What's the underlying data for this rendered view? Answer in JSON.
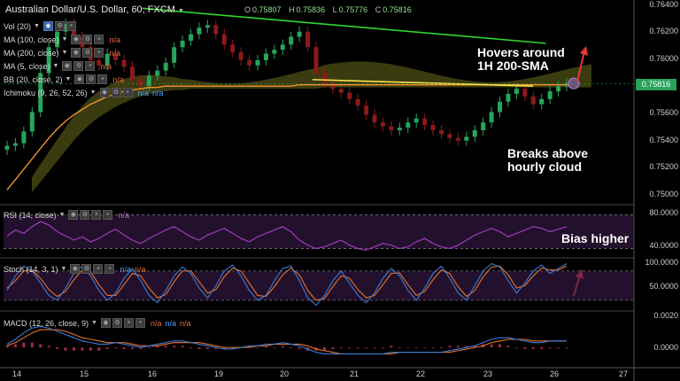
{
  "header": {
    "title": "Australian Dollar/U.S. Dollar, 60, FXCM",
    "ohlc": [
      {
        "k": "O",
        "v": "0.75807"
      },
      {
        "k": "H",
        "v": "0.75836"
      },
      {
        "k": "L",
        "v": "0.75776"
      },
      {
        "k": "C",
        "v": "0.75816"
      }
    ]
  },
  "legends": {
    "vol": "Vol (20)",
    "ma100": "MA (100, close)",
    "ma200": "MA (200, close)",
    "ma5": "MA (5, close)",
    "bb": "BB (20, close, 2)",
    "ichimoku": "Ichimoku (9, 26, 52, 26)",
    "rsi": "RSI (14, close)",
    "stoch": "Stoch (14, 3, 1)",
    "macd": "MACD (12, 26, close, 9)",
    "na": "n/a"
  },
  "annotations": {
    "hover_line1": "Hovers around",
    "hover_line2": "1H 200-SMA",
    "break_line1": "Breaks above",
    "break_line2": "hourly cloud",
    "bias": "Bias higher"
  },
  "last_price": "0.75816",
  "colors": {
    "background": "#000000",
    "bull_candle": "#26a65b",
    "bear_candle": "#8b1a1a",
    "sma200": "#f0932b",
    "trend_green": "#2fd62f",
    "trend_yellow": "#f5e04c",
    "cloud": "#6b6b1e",
    "rsi_line": "#9b3fb5",
    "stoch_k": "#3a7bd5",
    "stoch_d": "#e6742b",
    "macd_line": "#3a7bd5",
    "signal_line": "#e6742b",
    "hist": "#c0305a",
    "arrow": "#e53935"
  },
  "chart_data": {
    "type": "line",
    "x_tick_labels": [
      "14",
      "15",
      "16",
      "19",
      "20",
      "21",
      "22",
      "23",
      "26",
      "27"
    ],
    "price_axis": {
      "ticks": [
        "0.76400",
        "0.76200",
        "0.76000",
        "0.75800",
        "0.75600",
        "0.75400",
        "0.75200",
        "0.75000"
      ],
      "ylim": [
        0.749,
        0.7645
      ]
    },
    "price_close": [
      0.7534,
      0.7536,
      0.7545,
      0.756,
      0.759,
      0.761,
      0.7622,
      0.7628,
      0.7618,
      0.761,
      0.76,
      0.7596,
      0.7605,
      0.76,
      0.7595,
      0.7585,
      0.758,
      0.7588,
      0.7592,
      0.7598,
      0.761,
      0.7615,
      0.762,
      0.7625,
      0.7627,
      0.762,
      0.7612,
      0.7606,
      0.76,
      0.7596,
      0.76,
      0.7605,
      0.7608,
      0.7612,
      0.7618,
      0.7622,
      0.761,
      0.759,
      0.7582,
      0.7578,
      0.7575,
      0.757,
      0.7565,
      0.7558,
      0.7552,
      0.7549,
      0.7546,
      0.7548,
      0.7552,
      0.7555,
      0.755,
      0.7546,
      0.7543,
      0.754,
      0.7538,
      0.7541,
      0.7546,
      0.7552,
      0.756,
      0.7568,
      0.7574,
      0.7578,
      0.7572,
      0.7566,
      0.757,
      0.7576,
      0.758,
      0.7582
    ],
    "sma200": [
      0.75,
      0.7508,
      0.7516,
      0.7524,
      0.7532,
      0.754,
      0.7547,
      0.7553,
      0.7558,
      0.7562,
      0.7566,
      0.7569,
      0.7572,
      0.7574,
      0.7576,
      0.7577,
      0.7578,
      0.7579,
      0.7579,
      0.758,
      0.758,
      0.758,
      0.758,
      0.758,
      0.758,
      0.758,
      0.758,
      0.758,
      0.758,
      0.758,
      0.758,
      0.758,
      0.758,
      0.758,
      0.758,
      0.7581,
      0.7581,
      0.7581,
      0.7581,
      0.7581,
      0.7581,
      0.7581,
      0.7581,
      0.7581,
      0.7581,
      0.7581,
      0.7581,
      0.7581,
      0.7581,
      0.7581,
      0.7581,
      0.7581,
      0.7581,
      0.7581,
      0.7581,
      0.7581,
      0.7581,
      0.7581,
      0.7581,
      0.7581,
      0.7581,
      0.7581,
      0.7581,
      0.7581,
      0.7581,
      0.7581,
      0.7581,
      0.7581
    ],
    "trendline_green": {
      "x": [
        0.22,
        0.86
      ],
      "y": [
        0.764,
        0.7613
      ]
    },
    "trendline_yellow": {
      "x": [
        0.49,
        0.84
      ],
      "y": [
        0.7585,
        0.758
      ]
    },
    "rsi": {
      "ticks": [
        "80.0000",
        "40.0000"
      ],
      "ylim": [
        30,
        90
      ],
      "values": [
        55,
        62,
        58,
        66,
        72,
        68,
        60,
        55,
        50,
        54,
        48,
        52,
        58,
        63,
        56,
        50,
        46,
        52,
        57,
        62,
        66,
        60,
        54,
        50,
        56,
        60,
        64,
        58,
        52,
        48,
        54,
        58,
        62,
        66,
        60,
        50,
        44,
        40,
        42,
        46,
        50,
        44,
        40,
        38,
        42,
        46,
        44,
        40,
        42,
        48,
        52,
        46,
        42,
        40,
        44,
        50,
        56,
        60,
        64,
        60,
        54,
        58,
        62,
        66,
        64,
        60,
        63,
        66
      ]
    },
    "stoch": {
      "ticks": [
        "100.0000",
        "50.0000"
      ],
      "ylim": [
        0,
        105
      ],
      "k": [
        40,
        70,
        90,
        80,
        55,
        30,
        20,
        45,
        75,
        90,
        70,
        40,
        20,
        35,
        65,
        85,
        60,
        30,
        15,
        40,
        70,
        88,
        75,
        45,
        25,
        50,
        80,
        92,
        70,
        40,
        20,
        30,
        60,
        85,
        90,
        60,
        25,
        10,
        30,
        60,
        80,
        55,
        30,
        15,
        35,
        65,
        85,
        70,
        40,
        20,
        45,
        75,
        90,
        65,
        35,
        20,
        50,
        80,
        95,
        88,
        60,
        35,
        55,
        80,
        92,
        75,
        85,
        95
      ],
      "d": [
        45,
        60,
        80,
        82,
        65,
        42,
        28,
        38,
        62,
        82,
        78,
        52,
        30,
        30,
        52,
        75,
        70,
        45,
        25,
        32,
        58,
        80,
        80,
        58,
        35,
        42,
        68,
        86,
        80,
        55,
        30,
        28,
        48,
        72,
        86,
        72,
        40,
        20,
        24,
        48,
        70,
        65,
        42,
        25,
        30,
        52,
        75,
        76,
        52,
        30,
        38,
        62,
        82,
        75,
        48,
        28,
        40,
        68,
        88,
        90,
        72,
        45,
        50,
        70,
        86,
        82,
        82,
        90
      ]
    },
    "macd": {
      "ticks": [
        "0.0020",
        "0.0000"
      ],
      "ylim": [
        -0.0012,
        0.0022
      ],
      "macd": [
        0.0002,
        0.0005,
        0.0009,
        0.0012,
        0.0013,
        0.0012,
        0.001,
        0.0008,
        0.0006,
        0.0004,
        0.0003,
        0.0002,
        0.0002,
        0.0003,
        0.0002,
        0.0001,
        0.0,
        0.0001,
        0.0002,
        0.0003,
        0.0004,
        0.0004,
        0.0003,
        0.0002,
        0.0001,
        0.0,
        -0.0001,
        -0.0001,
        0.0,
        0.0001,
        0.0001,
        0.0002,
        0.0002,
        0.0003,
        0.0002,
        0.0001,
        -0.0001,
        -0.0003,
        -0.0004,
        -0.0004,
        -0.0004,
        -0.0004,
        -0.0004,
        -0.0004,
        -0.0004,
        -0.0004,
        -0.0003,
        -0.0003,
        -0.0003,
        -0.0003,
        -0.0003,
        -0.0003,
        -0.0003,
        -0.0002,
        -0.0001,
        0.0,
        0.0001,
        0.0003,
        0.0005,
        0.0006,
        0.0006,
        0.0005,
        0.0004,
        0.0003,
        0.0003,
        0.0004,
        0.0004,
        0.0004
      ],
      "signal": [
        0.0001,
        0.0003,
        0.0006,
        0.0009,
        0.0011,
        0.0011,
        0.0011,
        0.001,
        0.0008,
        0.0006,
        0.0005,
        0.0004,
        0.0003,
        0.0003,
        0.0003,
        0.0002,
        0.0001,
        0.0001,
        0.0001,
        0.0002,
        0.0003,
        0.0003,
        0.0003,
        0.0003,
        0.0002,
        0.0001,
        0.0,
        0.0,
        0.0,
        0.0,
        0.0001,
        0.0001,
        0.0002,
        0.0002,
        0.0002,
        0.0002,
        0.0001,
        -0.0001,
        -0.0002,
        -0.0003,
        -0.0004,
        -0.0004,
        -0.0004,
        -0.0004,
        -0.0004,
        -0.0004,
        -0.0004,
        -0.0003,
        -0.0003,
        -0.0003,
        -0.0003,
        -0.0003,
        -0.0003,
        -0.0003,
        -0.0002,
        -0.0001,
        0.0,
        0.0001,
        0.0003,
        0.0004,
        0.0005,
        0.0005,
        0.0005,
        0.0004,
        0.0004,
        0.0004,
        0.0004,
        0.0004
      ]
    }
  }
}
